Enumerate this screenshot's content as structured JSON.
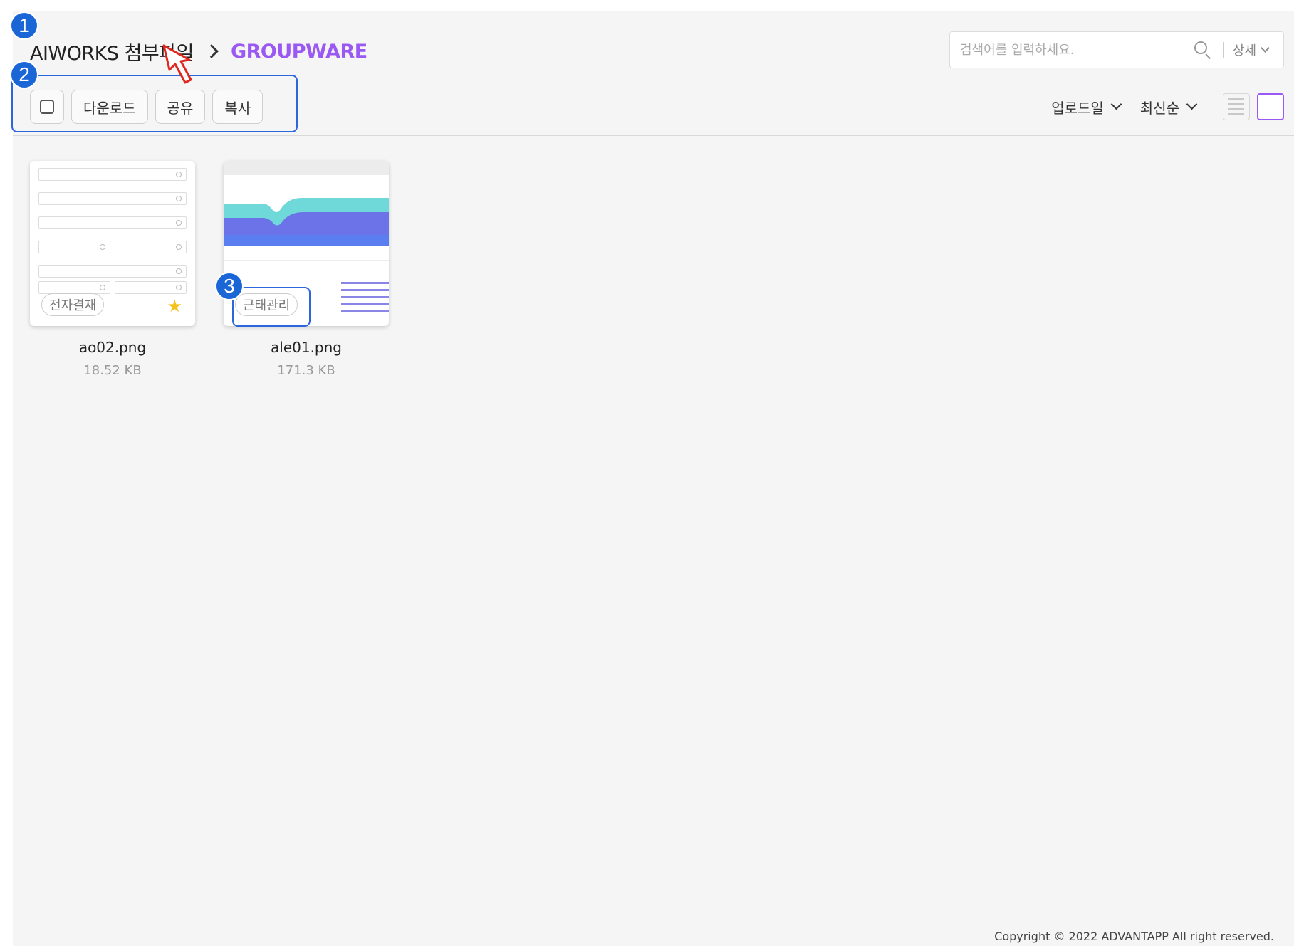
{
  "breadcrumb": {
    "root": "AIWORKS 첨부파일",
    "current": "GROUPWARE"
  },
  "search": {
    "placeholder": "검색어를 입력하세요.",
    "detail_label": "상세"
  },
  "toolbar": {
    "download_label": "다운로드",
    "share_label": "공유",
    "copy_label": "복사"
  },
  "sort": {
    "field_label": "업로드일",
    "order_label": "최신순"
  },
  "view_mode": "grid",
  "files": [
    {
      "name": "ao02.png",
      "size": "18.52 KB",
      "tag": "전자결재",
      "starred": true
    },
    {
      "name": "ale01.png",
      "size": "171.3 KB",
      "tag": "근태관리",
      "starred": false
    }
  ],
  "footer": {
    "copyright": "Copyright © 2022 ADVANTAPP All right reserved."
  },
  "annotations": {
    "step1": "1",
    "step2": "2",
    "step3": "3"
  },
  "colors": {
    "accent": "#9b59f3",
    "annotation": "#1a66d6"
  }
}
